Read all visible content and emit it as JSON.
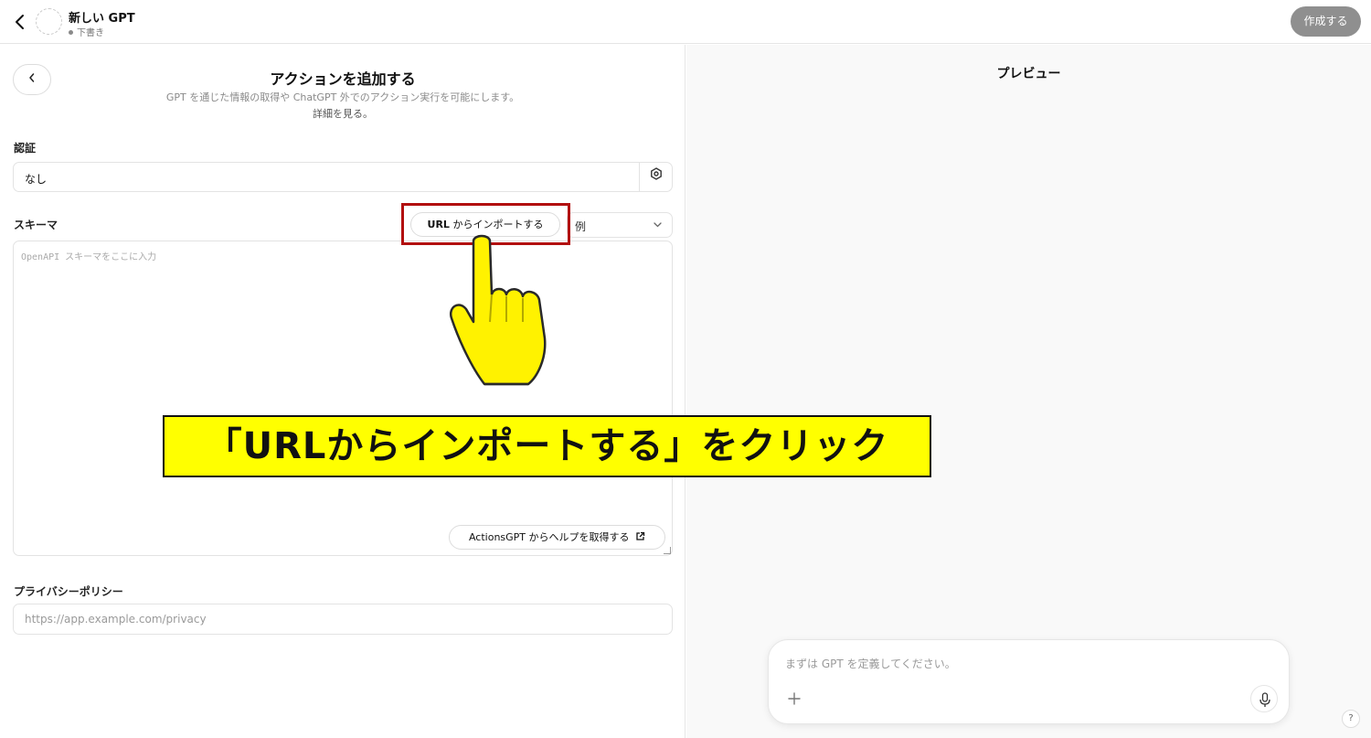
{
  "topbar": {
    "gpt_name": "新しい GPT",
    "gpt_status": "下書き",
    "create_label": "作成する"
  },
  "left": {
    "back_symbol": "‹",
    "title": "アクションを追加する",
    "subtitle": "GPT を通じた情報の取得や ChatGPT 外でのアクション実行を可能にします。",
    "more_link": "詳細を見る。",
    "auth": {
      "label": "認証",
      "value": "なし",
      "icon": "gear-icon"
    },
    "schema": {
      "label": "スキーマ",
      "import_prefix": "URL",
      "import_suffix": " からインポートする",
      "example_label": "例",
      "placeholder": "OpenAPI スキーマをここに入力",
      "help_button": "ActionsGPT からヘルプを取得する"
    },
    "privacy": {
      "label": "プライバシーポリシー",
      "placeholder": "https://app.example.com/privacy"
    }
  },
  "right": {
    "preview_title": "プレビュー",
    "chat_placeholder": "まずは GPT を定義してください。",
    "help_symbol": "?"
  },
  "annotation": {
    "callout_text": "「URLからインポートする」をクリック",
    "box_color": "#b20f0f",
    "callout_bg": "#ffff00"
  }
}
